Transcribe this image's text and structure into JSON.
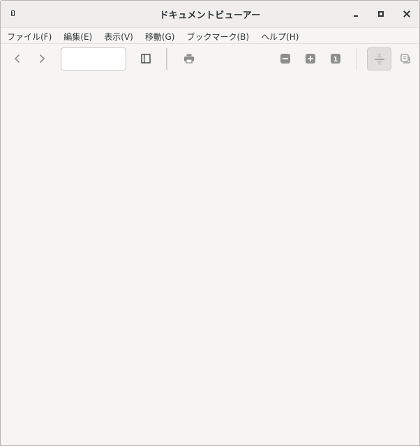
{
  "window": {
    "title": "ドキュメントビューアー"
  },
  "menubar": {
    "items": [
      {
        "label": "ファイル(F)"
      },
      {
        "label": "編集(E)"
      },
      {
        "label": "表示(V)"
      },
      {
        "label": "移動(G)"
      },
      {
        "label": "ブックマーク(B)"
      },
      {
        "label": "ヘルプ(H)"
      }
    ]
  },
  "toolbar": {
    "page_current": "",
    "page_total": "",
    "zoom_reset_label": "1",
    "icons": {
      "back": "chevron-left-icon",
      "forward": "chevron-right-icon",
      "sidebar": "sidebar-icon",
      "print": "printer-icon",
      "zoom_out": "zoom-out-icon",
      "zoom_in": "zoom-in-icon",
      "zoom_reset": "zoom-original-icon",
      "continuous": "continuous-scroll-icon",
      "dual": "dual-page-icon"
    }
  },
  "colors": {
    "background": "#f6f5f4",
    "titlebar": "#efeeec",
    "text": "#2e3436",
    "icon": "#8d8f8c",
    "toggle_active": "#e1dedb"
  }
}
